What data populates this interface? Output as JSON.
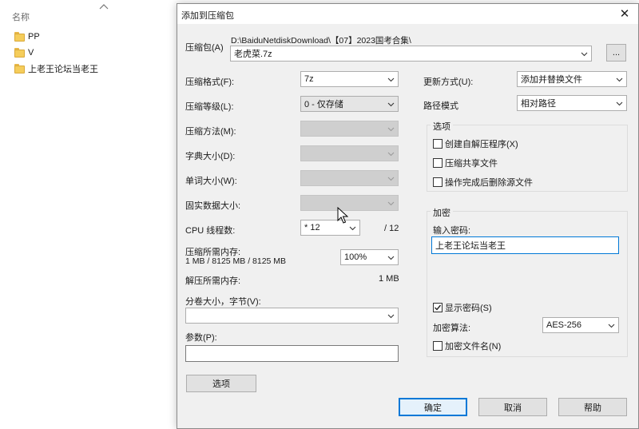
{
  "explorer": {
    "column_header": "名称",
    "files": [
      {
        "name": "PP",
        "icon": "folder-icon"
      },
      {
        "name": "V",
        "icon": "folder-icon"
      },
      {
        "name": "上老王论坛当老王",
        "icon": "folder-icon"
      }
    ]
  },
  "dialog": {
    "title": "添加到压缩包",
    "close_label": "✕",
    "archive": {
      "label": "压缩包(A)",
      "path": "D:\\BaiduNetdiskDownload\\【07】2023国考合集\\",
      "filename": "老虎菜.7z",
      "browse_label": "..."
    },
    "left": {
      "format_label": "压缩格式(F):",
      "format_value": "7z",
      "level_label": "压缩等级(L):",
      "level_value": "0 - 仅存储",
      "method_label": "压缩方法(M):",
      "dict_label": "字典大小(D):",
      "word_label": "单词大小(W):",
      "solid_label": "固实数据大小:",
      "cpu_label": "CPU 线程数:",
      "cpu_value": "* 12",
      "cpu_total": "/ 12",
      "mem_comp_label": "压缩所需内存:",
      "mem_comp_value": "1 MB / 8125 MB / 8125 MB",
      "mem_percent": "100%",
      "mem_decomp_label": "解压所需内存:",
      "mem_decomp_value": "1 MB",
      "split_label": "分卷大小，字节(V):",
      "split_value": "",
      "params_label": "参数(P):",
      "params_value": "",
      "options_button": "选项"
    },
    "right": {
      "update_label": "更新方式(U):",
      "update_value": "添加并替换文件",
      "path_label": "路径模式",
      "path_value": "相对路径",
      "options_group": "选项",
      "opt_sfx": "创建自解压程序(X)",
      "opt_shared": "压缩共享文件",
      "opt_delete": "操作完成后删除源文件",
      "encrypt_group": "加密",
      "password_label": "输入密码:",
      "password_value": "上老王论坛当老王",
      "show_password": "显示密码(S)",
      "algo_label": "加密算法:",
      "algo_value": "AES-256",
      "encrypt_names": "加密文件名(N)"
    },
    "buttons": {
      "ok": "确定",
      "cancel": "取消",
      "help": "帮助"
    },
    "colors": {
      "accent": "#0078d7",
      "folder": "#f5cd5b"
    }
  }
}
